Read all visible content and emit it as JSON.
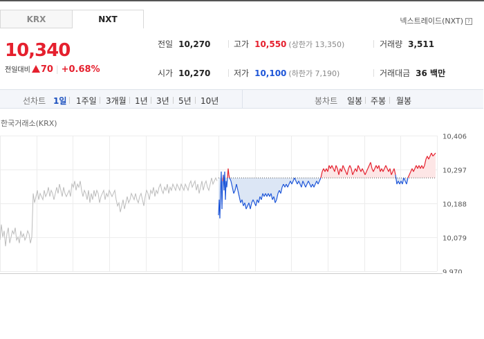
{
  "tabs": [
    {
      "label": "KRX",
      "active": false
    },
    {
      "label": "NXT",
      "active": true
    }
  ],
  "exchange_link": {
    "label": "넥스트레이드(NXT)",
    "help": "?"
  },
  "quote": {
    "price": "10,340",
    "change_label": "전일대비",
    "change": "70",
    "change_pct": "+0.68%",
    "prev_close": {
      "label": "전일",
      "value": "10,270"
    },
    "open": {
      "label": "시가",
      "value": "10,270"
    },
    "high": {
      "label": "고가",
      "value": "10,550",
      "sub": "(상한가 13,350)"
    },
    "low": {
      "label": "저가",
      "value": "10,100",
      "sub": "(하한가 7,190)"
    },
    "volume": {
      "label": "거래량",
      "value": "3,511"
    },
    "amount": {
      "label": "거래대금",
      "value": "36 백만"
    }
  },
  "period_bar": {
    "line_label": "선차트",
    "line_options": [
      "1일",
      "1주일",
      "3개월",
      "1년",
      "3년",
      "5년",
      "10년"
    ],
    "active": "1일",
    "candle_label": "봉차트",
    "candle_options": [
      "일봉",
      "주봉",
      "월봉"
    ]
  },
  "colors": {
    "up": "#e5202e",
    "down": "#1e56d8",
    "history": "#bbbbbb",
    "up_fill": "#fde6e6",
    "down_fill": "#dce6f5"
  },
  "chart_data": {
    "type": "line",
    "title": "한국거래소(KRX)",
    "yticks": [
      "10,406",
      "10,297",
      "10,188",
      "10,079",
      "9,970"
    ],
    "ylim": [
      9970,
      10406
    ],
    "reference": 10270,
    "grid": true,
    "history_series": [
      [
        0,
        10070
      ],
      [
        2,
        10120
      ],
      [
        4,
        10080
      ],
      [
        6,
        10100
      ],
      [
        8,
        10050
      ],
      [
        10,
        10090
      ],
      [
        12,
        10110
      ],
      [
        14,
        10060
      ],
      [
        16,
        10080
      ],
      [
        18,
        10100
      ],
      [
        20,
        10090
      ],
      [
        22,
        10110
      ],
      [
        24,
        10070
      ],
      [
        26,
        10080
      ],
      [
        28,
        10060
      ],
      [
        30,
        10100
      ],
      [
        32,
        10080
      ],
      [
        34,
        10090
      ],
      [
        36,
        10070
      ],
      [
        38,
        10080
      ],
      [
        40,
        10100
      ],
      [
        42,
        10090
      ],
      [
        44,
        10060
      ],
      [
        46,
        10080
      ],
      [
        48,
        10220
      ],
      [
        50,
        10190
      ],
      [
        52,
        10210
      ],
      [
        54,
        10230
      ],
      [
        56,
        10200
      ],
      [
        58,
        10220
      ],
      [
        60,
        10210
      ],
      [
        62,
        10200
      ],
      [
        64,
        10230
      ],
      [
        66,
        10210
      ],
      [
        68,
        10220
      ],
      [
        70,
        10240
      ],
      [
        72,
        10210
      ],
      [
        74,
        10230
      ],
      [
        76,
        10220
      ],
      [
        78,
        10200
      ],
      [
        80,
        10220
      ],
      [
        82,
        10240
      ],
      [
        84,
        10220
      ],
      [
        86,
        10250
      ],
      [
        88,
        10230
      ],
      [
        90,
        10210
      ],
      [
        92,
        10240
      ],
      [
        94,
        10220
      ],
      [
        96,
        10210
      ],
      [
        98,
        10220
      ],
      [
        100,
        10230
      ],
      [
        102,
        10210
      ],
      [
        104,
        10250
      ],
      [
        106,
        10240
      ],
      [
        108,
        10260
      ],
      [
        110,
        10230
      ],
      [
        112,
        10250
      ],
      [
        114,
        10240
      ],
      [
        116,
        10260
      ],
      [
        118,
        10230
      ],
      [
        120,
        10210
      ],
      [
        122,
        10230
      ],
      [
        124,
        10220
      ],
      [
        126,
        10200
      ],
      [
        128,
        10230
      ],
      [
        130,
        10190
      ],
      [
        132,
        10220
      ],
      [
        134,
        10200
      ],
      [
        136,
        10230
      ],
      [
        138,
        10210
      ],
      [
        140,
        10230
      ],
      [
        142,
        10220
      ],
      [
        144,
        10190
      ],
      [
        146,
        10210
      ],
      [
        148,
        10220
      ],
      [
        150,
        10230
      ],
      [
        152,
        10200
      ],
      [
        154,
        10220
      ],
      [
        156,
        10210
      ],
      [
        158,
        10230
      ],
      [
        160,
        10220
      ],
      [
        162,
        10210
      ],
      [
        164,
        10220
      ],
      [
        166,
        10230
      ],
      [
        168,
        10200
      ],
      [
        170,
        10180
      ],
      [
        172,
        10190
      ],
      [
        174,
        10160
      ],
      [
        176,
        10180
      ],
      [
        178,
        10200
      ],
      [
        180,
        10170
      ],
      [
        182,
        10190
      ],
      [
        184,
        10210
      ],
      [
        186,
        10190
      ],
      [
        188,
        10200
      ],
      [
        190,
        10220
      ],
      [
        192,
        10210
      ],
      [
        194,
        10200
      ],
      [
        196,
        10220
      ],
      [
        198,
        10200
      ],
      [
        200,
        10190
      ],
      [
        202,
        10210
      ],
      [
        204,
        10220
      ],
      [
        206,
        10200
      ],
      [
        208,
        10180
      ],
      [
        210,
        10210
      ],
      [
        212,
        10230
      ],
      [
        214,
        10220
      ],
      [
        216,
        10200
      ],
      [
        218,
        10230
      ],
      [
        220,
        10220
      ],
      [
        222,
        10240
      ],
      [
        224,
        10210
      ],
      [
        226,
        10230
      ],
      [
        228,
        10220
      ],
      [
        230,
        10240
      ],
      [
        232,
        10250
      ],
      [
        234,
        10230
      ],
      [
        236,
        10220
      ],
      [
        238,
        10240
      ],
      [
        240,
        10230
      ],
      [
        242,
        10250
      ],
      [
        244,
        10220
      ],
      [
        246,
        10240
      ],
      [
        248,
        10230
      ],
      [
        250,
        10250
      ],
      [
        252,
        10240
      ],
      [
        254,
        10230
      ],
      [
        256,
        10250
      ],
      [
        258,
        10240
      ],
      [
        260,
        10230
      ],
      [
        262,
        10250
      ],
      [
        264,
        10240
      ],
      [
        266,
        10230
      ],
      [
        268,
        10250
      ],
      [
        270,
        10240
      ],
      [
        272,
        10230
      ],
      [
        274,
        10250
      ],
      [
        276,
        10260
      ],
      [
        278,
        10240
      ],
      [
        280,
        10250
      ],
      [
        282,
        10260
      ],
      [
        284,
        10230
      ],
      [
        286,
        10250
      ],
      [
        288,
        10220
      ],
      [
        290,
        10240
      ],
      [
        292,
        10260
      ],
      [
        294,
        10230
      ],
      [
        296,
        10250
      ],
      [
        298,
        10260
      ],
      [
        300,
        10240
      ],
      [
        302,
        10230
      ],
      [
        304,
        10250
      ],
      [
        306,
        10270
      ],
      [
        308,
        10250
      ],
      [
        310,
        10260
      ],
      [
        312,
        10270
      ],
      [
        314,
        10260
      ]
    ],
    "today_series": [
      [
        316,
        10150
      ],
      [
        317,
        10200
      ],
      [
        318,
        10140
      ],
      [
        319,
        10230
      ],
      [
        320,
        10290
      ],
      [
        321,
        10170
      ],
      [
        322,
        10260
      ],
      [
        323,
        10280
      ],
      [
        324,
        10230
      ],
      [
        325,
        10290
      ],
      [
        326,
        10200
      ],
      [
        327,
        10260
      ],
      [
        328,
        10240
      ],
      [
        329,
        10270
      ],
      [
        330,
        10300
      ],
      [
        331,
        10280
      ],
      [
        332,
        10270
      ],
      [
        334,
        10260
      ],
      [
        336,
        10240
      ],
      [
        338,
        10220
      ],
      [
        340,
        10230
      ],
      [
        342,
        10250
      ],
      [
        344,
        10230
      ],
      [
        346,
        10210
      ],
      [
        348,
        10190
      ],
      [
        350,
        10200
      ],
      [
        352,
        10180
      ],
      [
        354,
        10190
      ],
      [
        356,
        10170
      ],
      [
        358,
        10180
      ],
      [
        360,
        10190
      ],
      [
        362,
        10170
      ],
      [
        364,
        10190
      ],
      [
        366,
        10200
      ],
      [
        368,
        10190
      ],
      [
        370,
        10180
      ],
      [
        372,
        10200
      ],
      [
        374,
        10190
      ],
      [
        376,
        10210
      ],
      [
        378,
        10200
      ],
      [
        380,
        10220
      ],
      [
        382,
        10210
      ],
      [
        384,
        10220
      ],
      [
        386,
        10210
      ],
      [
        388,
        10220
      ],
      [
        390,
        10210
      ],
      [
        392,
        10220
      ],
      [
        394,
        10200
      ],
      [
        396,
        10210
      ],
      [
        398,
        10190
      ],
      [
        400,
        10200
      ],
      [
        402,
        10220
      ],
      [
        404,
        10230
      ],
      [
        406,
        10220
      ],
      [
        408,
        10240
      ],
      [
        410,
        10250
      ],
      [
        412,
        10240
      ],
      [
        414,
        10250
      ],
      [
        416,
        10240
      ],
      [
        418,
        10250
      ],
      [
        420,
        10260
      ],
      [
        422,
        10250
      ],
      [
        424,
        10260
      ],
      [
        426,
        10270
      ],
      [
        428,
        10260
      ],
      [
        430,
        10250
      ],
      [
        432,
        10260
      ],
      [
        434,
        10250
      ],
      [
        436,
        10240
      ],
      [
        438,
        10260
      ],
      [
        440,
        10250
      ],
      [
        442,
        10240
      ],
      [
        444,
        10250
      ],
      [
        446,
        10260
      ],
      [
        448,
        10250
      ],
      [
        450,
        10240
      ],
      [
        452,
        10250
      ],
      [
        454,
        10240
      ],
      [
        456,
        10250
      ],
      [
        458,
        10260
      ],
      [
        460,
        10250
      ],
      [
        462,
        10260
      ],
      [
        464,
        10270
      ],
      [
        466,
        10290
      ],
      [
        468,
        10300
      ],
      [
        470,
        10290
      ],
      [
        472,
        10300
      ],
      [
        474,
        10290
      ],
      [
        476,
        10310
      ],
      [
        478,
        10300
      ],
      [
        480,
        10310
      ],
      [
        482,
        10300
      ],
      [
        484,
        10290
      ],
      [
        486,
        10310
      ],
      [
        488,
        10300
      ],
      [
        490,
        10280
      ],
      [
        492,
        10300
      ],
      [
        494,
        10290
      ],
      [
        496,
        10310
      ],
      [
        498,
        10300
      ],
      [
        500,
        10290
      ],
      [
        502,
        10280
      ],
      [
        504,
        10300
      ],
      [
        506,
        10310
      ],
      [
        508,
        10300
      ],
      [
        510,
        10280
      ],
      [
        512,
        10290
      ],
      [
        514,
        10300
      ],
      [
        516,
        10290
      ],
      [
        518,
        10310
      ],
      [
        520,
        10300
      ],
      [
        522,
        10290
      ],
      [
        524,
        10300
      ],
      [
        526,
        10290
      ],
      [
        528,
        10280
      ],
      [
        530,
        10290
      ],
      [
        532,
        10300
      ],
      [
        534,
        10310
      ],
      [
        536,
        10320
      ],
      [
        538,
        10300
      ],
      [
        540,
        10290
      ],
      [
        542,
        10300
      ],
      [
        544,
        10310
      ],
      [
        546,
        10300
      ],
      [
        548,
        10310
      ],
      [
        550,
        10290
      ],
      [
        552,
        10300
      ],
      [
        554,
        10290
      ],
      [
        556,
        10300
      ],
      [
        558,
        10310
      ],
      [
        560,
        10300
      ],
      [
        562,
        10290
      ],
      [
        564,
        10300
      ],
      [
        566,
        10280
      ],
      [
        568,
        10290
      ],
      [
        570,
        10300
      ],
      [
        572,
        10280
      ],
      [
        574,
        10250
      ],
      [
        576,
        10260
      ],
      [
        578,
        10250
      ],
      [
        580,
        10260
      ],
      [
        582,
        10250
      ],
      [
        584,
        10270
      ],
      [
        586,
        10260
      ],
      [
        588,
        10250
      ],
      [
        590,
        10270
      ],
      [
        592,
        10280
      ],
      [
        594,
        10290
      ],
      [
        596,
        10300
      ],
      [
        598,
        10290
      ],
      [
        600,
        10300
      ],
      [
        602,
        10310
      ],
      [
        604,
        10300
      ],
      [
        606,
        10310
      ],
      [
        608,
        10300
      ],
      [
        610,
        10310
      ],
      [
        612,
        10300
      ],
      [
        614,
        10310
      ],
      [
        616,
        10330
      ],
      [
        618,
        10340
      ],
      [
        620,
        10330
      ],
      [
        622,
        10340
      ],
      [
        624,
        10350
      ],
      [
        626,
        10340
      ],
      [
        628,
        10345
      ],
      [
        630,
        10350
      ]
    ]
  }
}
